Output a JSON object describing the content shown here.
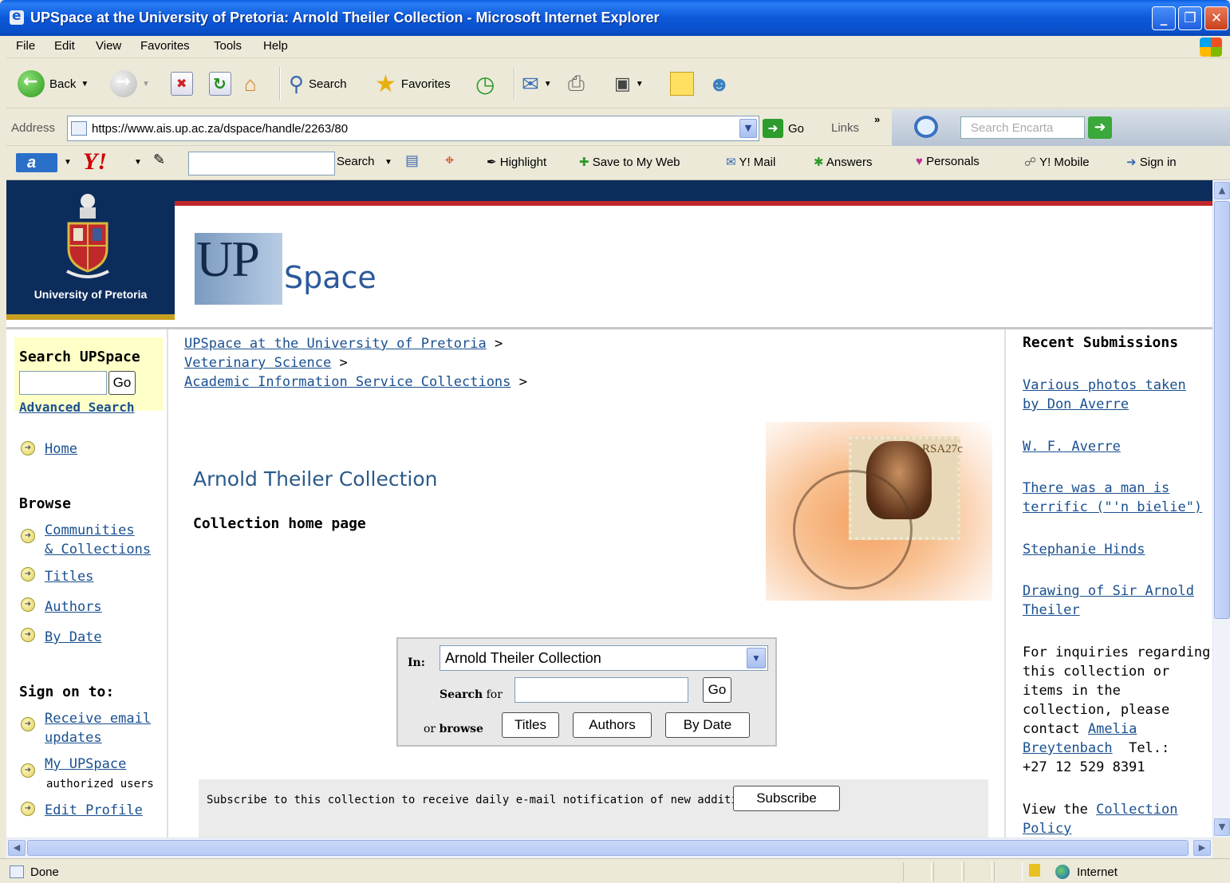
{
  "window": {
    "title": "UPSpace at the University of Pretoria: Arnold Theiler Collection - Microsoft Internet Explorer"
  },
  "menu": [
    "File",
    "Edit",
    "View",
    "Favorites",
    "Tools",
    "Help"
  ],
  "toolbar": {
    "back": "Back",
    "search": "Search",
    "favorites": "Favorites"
  },
  "address": {
    "label": "Address",
    "url": "https://www.ais.up.ac.za/dspace/handle/2263/80",
    "go": "Go",
    "links": "Links",
    "encarta_placeholder": "Search Encarta"
  },
  "yahoo": {
    "search": "Search",
    "highlight": "Highlight",
    "save_to_web": "Save to My Web",
    "mail": "Y! Mail",
    "answers": "Answers",
    "personals": "Personals",
    "mobile": "Y! Mobile",
    "sign_in": "Sign in"
  },
  "header": {
    "university": "University of Pretoria",
    "logo_up": "UP",
    "logo_space": "Space"
  },
  "sidebar": {
    "search_heading": "Search UPSpace",
    "go": "Go",
    "advanced": "Advanced Search",
    "home": "Home",
    "browse_heading": "Browse",
    "communities_1": "Communities",
    "communities_2": "& Collections",
    "titles": "Titles",
    "authors": "Authors",
    "by_date": "By Date",
    "sign_heading": "Sign on to:",
    "receive_1": "Receive email",
    "receive_2": "updates",
    "my_upspace": "My UPSpace",
    "authorized": "authorized users",
    "edit_profile": "Edit Profile"
  },
  "breadcrumb": [
    "UPSpace at the University of Pretoria",
    "Veterinary Science",
    "Academic Information Service Collections"
  ],
  "breadcrumb_sep": ">",
  "main": {
    "title": "Arnold Theiler Collection",
    "subtitle": "Collection home page",
    "stamp_text": "RSA27c"
  },
  "search_form": {
    "in_label": "In:",
    "scope": "Arnold Theiler Collection",
    "search_for_1": "Search",
    "search_for_2": "for",
    "go": "Go",
    "or_browse_1": "or",
    "or_browse_2": "browse",
    "titles": "Titles",
    "authors": "Authors",
    "by_date": "By Date"
  },
  "subscribe": {
    "text": "Subscribe to this collection to receive daily e-mail notification of new additions",
    "button": "Subscribe"
  },
  "recent": {
    "heading": "Recent Submissions",
    "items": [
      [
        "Various photos taken",
        "by Don Averre"
      ],
      [
        "W. F. Averre"
      ],
      [
        "There was a man is",
        "terrific (\"'n bielie\")"
      ],
      [
        "Stephanie Hinds"
      ],
      [
        "Drawing of Sir Arnold",
        "Theiler"
      ]
    ],
    "inquiry_1": "For inquiries regarding",
    "inquiry_2": "this collection or",
    "inquiry_3": "items in the",
    "inquiry_4": "collection, please",
    "inquiry_5": "contact",
    "contact_1": "Amelia",
    "contact_2": "Breytenbach",
    "tel": "Tel.:",
    "phone": "+27 12 529 8391",
    "view": "View the",
    "policy_1": "Collection",
    "policy_2": "Policy"
  },
  "status": {
    "text": "Done",
    "zone": "Internet"
  }
}
